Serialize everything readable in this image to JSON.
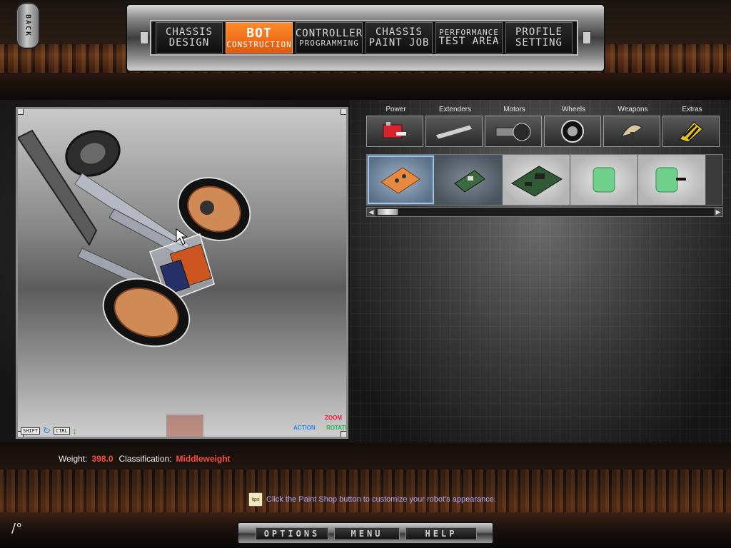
{
  "back": {
    "label": "BACK"
  },
  "nav": {
    "tabs": [
      {
        "line1": "CHASSIS",
        "line2": "DESIGN"
      },
      {
        "line1": "BOT",
        "line2": "CONSTRUCTION",
        "active": true
      },
      {
        "line1": "CONTROLLER",
        "line2": "PROGRAMMING"
      },
      {
        "line1": "CHASSIS",
        "line2": "PAINT JOB"
      },
      {
        "line1": "PERFORMANCE",
        "line2": "TEST AREA"
      },
      {
        "line1": "PROFILE",
        "line2": "SETTING"
      }
    ]
  },
  "viewport": {
    "hint_shift": "SHIFT",
    "hint_ctrl": "CTRL",
    "zoom_label": "ZOOM",
    "action_label": "ACTION",
    "rotate_label": "ROTATE"
  },
  "categories": [
    {
      "label": "Power",
      "icon": "battery-icon"
    },
    {
      "label": "Extenders",
      "icon": "extender-bar-icon"
    },
    {
      "label": "Motors",
      "icon": "motor-icon"
    },
    {
      "label": "Wheels",
      "icon": "wheel-icon"
    },
    {
      "label": "Weapons",
      "icon": "saw-blade-icon"
    },
    {
      "label": "Extras",
      "icon": "hazard-stripe-icon"
    }
  ],
  "parts": [
    {
      "icon": "orange-circuit-board-icon"
    },
    {
      "icon": "green-circuit-board-icon"
    },
    {
      "icon": "large-circuit-board-icon"
    },
    {
      "icon": "green-receiver-icon"
    },
    {
      "icon": "green-receiver-antenna-icon"
    }
  ],
  "status": {
    "weight_label": "Weight:",
    "weight_value": "398.0",
    "classification_label": "Classification:",
    "classification_value": "Middleweight"
  },
  "tip": {
    "icon_label": "tips",
    "text": "Click the Paint Shop button to customize your robot's appearance."
  },
  "bottom_menu": {
    "options": "OPTIONS",
    "menu": "MENU",
    "help": "HELP"
  },
  "colors": {
    "active_tab": "#f06c1c",
    "stat_value": "#ff4c3a",
    "tip_text": "#a9a9ff"
  }
}
